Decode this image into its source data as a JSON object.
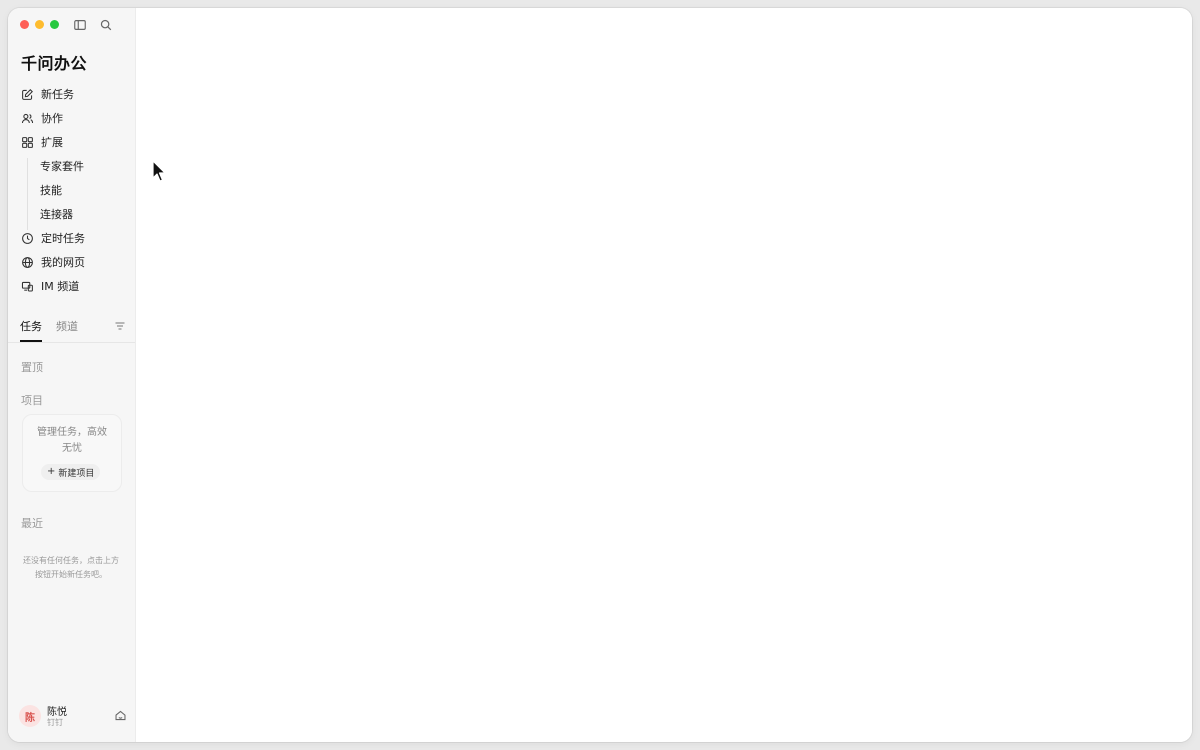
{
  "app": {
    "title": "千问办公"
  },
  "nav": {
    "new_task": "新任务",
    "collab": "协作",
    "extensions": "扩展",
    "extensions_sub": [
      "专家套件",
      "技能",
      "连接器"
    ],
    "scheduled": "定时任务",
    "my_pages": "我的网页",
    "im_channels": "IM 频道"
  },
  "tabs": {
    "tasks": "任务",
    "channels": "频道"
  },
  "sections": {
    "pinned": "置顶",
    "projects": "项目",
    "recent": "最近"
  },
  "project_card": {
    "empty_line1": "管理任务，高效",
    "empty_line2": "无忧",
    "new_button": "新建项目"
  },
  "recent_empty": {
    "line1": "还没有任何任务，点击上方",
    "line2": "按钮开始新任务吧。"
  },
  "user": {
    "avatar_text": "陈",
    "name": "陈悦",
    "org": "钉钉"
  },
  "colors": {
    "close": "#fe5f57",
    "minimize": "#febc2e",
    "zoom": "#28c840",
    "avatar_bg": "#fbe3e2",
    "avatar_fg": "#d9534f"
  },
  "icons": {
    "new_task": "edit-icon",
    "collab": "users-icon",
    "extensions": "grid-icon",
    "scheduled": "clock-icon",
    "my_pages": "globe-icon",
    "im_channels": "devices-icon",
    "filter": "filter-icon",
    "sidebar_toggle": "sidebar-icon",
    "search": "search-icon",
    "user_action": "home-switch-icon"
  }
}
